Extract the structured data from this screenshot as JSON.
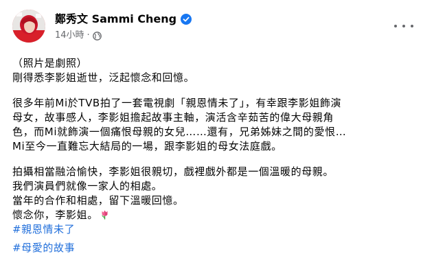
{
  "post": {
    "author": "鄭秀文 Sammi Cheng",
    "time": "14小時",
    "dot": "·",
    "content": {
      "p1": [
        "（照片是劇照）",
        "剛得悉李影姐逝世，泛起懷念和回憶。"
      ],
      "p2": [
        "很多年前Mi於TVB拍了一套電視劇「親恩情未了」，有幸跟李影姐飾演",
        "母女，故事感人，李影姐擔起故事主軸，演活含辛茹苦的偉大母親角",
        "色，而Mi就飾演一個痛恨母親的女兒……還有，兄弟姊妹之間的愛恨…",
        "Mi至今一直難忘大結局的一場，跟李影姐的母女法庭戲。"
      ],
      "p3": [
        "拍攝相當融洽愉快，李影姐很親切，戲裡戲外都是一個溫暖的母親。",
        "我們演員們就像一家人的相處。",
        "當年的合作和相處，留下溫暖回憶。",
        "懷念你，李影姐。"
      ],
      "hashtags": [
        "#親恩情未了",
        "#母愛的故事"
      ]
    },
    "icons": {
      "verified": "verified-badge-icon",
      "audience": "globe-icon",
      "more": "more-horizontal-icon",
      "emoji": "tulip-icon"
    },
    "colors": {
      "hashtag": "#216fdb",
      "verified": "#1877f2",
      "meta": "#65676b"
    }
  }
}
